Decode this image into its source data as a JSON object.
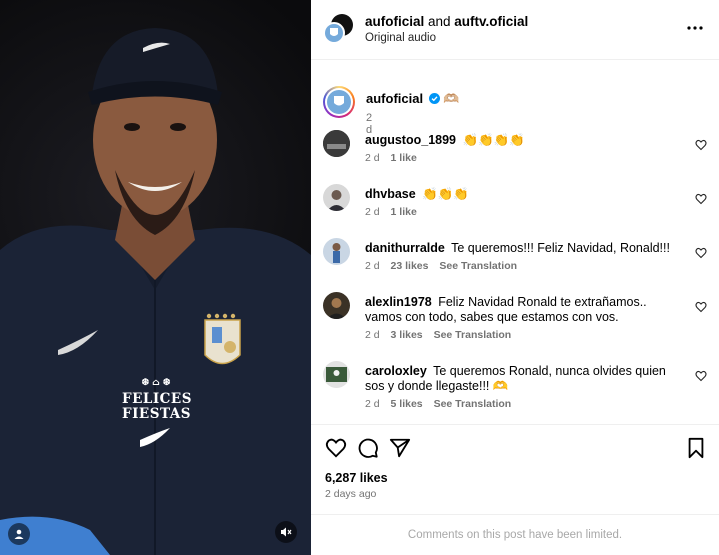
{
  "header": {
    "user_primary": "aufoficial",
    "joiner": " and ",
    "user_secondary": "auftv.oficial",
    "subtitle": "Original audio"
  },
  "media": {
    "overlay_text_line1": "FELICES",
    "overlay_text_line2": "FIESTAS",
    "mute_icon": "muted-speaker-icon",
    "tag_icon": "person-tag-icon"
  },
  "caption": {
    "username": "aufoficial",
    "emoji": "🫶🏼",
    "time": "2 d"
  },
  "comments": [
    {
      "username": "augustoo_1899",
      "text": "👏👏👏👏",
      "time": "2 d",
      "likes": "1 like",
      "translation": ""
    },
    {
      "username": "dhvbase",
      "text": "👏👏👏",
      "time": "2 d",
      "likes": "1 like",
      "translation": ""
    },
    {
      "username": "danithurralde",
      "text": "Te queremos!!! Feliz Navidad, Ronald!!!",
      "time": "2 d",
      "likes": "23 likes",
      "translation": "See Translation"
    },
    {
      "username": "alexlin1978",
      "text": "Feliz Navidad Ronald te extrañamos.. vamos con todo, sabes que estamos con vos.",
      "time": "2 d",
      "likes": "3 likes",
      "translation": "See Translation"
    },
    {
      "username": "caroloxley",
      "text": "Te queremos Ronald, nunca olvides quien sos y donde llegaste!!! 🫶",
      "time": "2 d",
      "likes": "5 likes",
      "translation": "See Translation"
    }
  ],
  "actions": {
    "likes": "6,287 likes",
    "date": "2 days ago"
  },
  "footer": {
    "limited": "Comments on this post have been limited."
  },
  "colors": {
    "link_blue": "#0095f6",
    "muted": "#737373",
    "verified": "#0095f6",
    "jersey": "#1b2233"
  }
}
